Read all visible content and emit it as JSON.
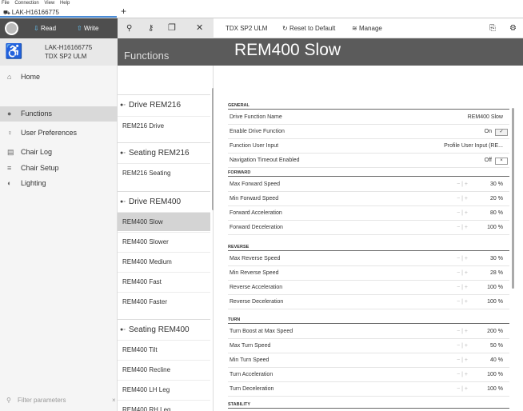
{
  "menu": [
    "File",
    "Connection",
    "View",
    "Help"
  ],
  "tab": {
    "title": "LAK-H16166775",
    "add": "+"
  },
  "toolbar": {
    "read": "Read",
    "write": "Write",
    "device": "TDX SP2 ULM",
    "reset": "Reset to Default",
    "manage": "Manage"
  },
  "device": {
    "id": "LAK-H16166775",
    "model": "TDX SP2 ULM"
  },
  "functions_header": "Functions",
  "page_title": "REM400 Slow",
  "sidebar": {
    "items": [
      {
        "label": "Home",
        "icon": "home-icon",
        "glyph": "⌂"
      },
      {
        "label": "Functions",
        "icon": "functions-icon",
        "glyph": "●"
      },
      {
        "label": "User Preferences",
        "icon": "user-icon",
        "glyph": "♀"
      },
      {
        "label": "Chair Log",
        "icon": "log-icon",
        "glyph": "▤"
      },
      {
        "label": "Chair Setup",
        "icon": "setup-icon",
        "glyph": "≡"
      },
      {
        "label": "Lighting",
        "icon": "lighting-icon",
        "glyph": "◐"
      }
    ],
    "filter_placeholder": "Filter parameters"
  },
  "functions": {
    "groups": [
      {
        "title": "Drive REM216",
        "items": [
          "REM216 Drive"
        ]
      },
      {
        "title": "Seating REM216",
        "items": [
          "REM216 Seating"
        ]
      },
      {
        "title": "Drive REM400",
        "items": [
          "REM400 Slow",
          "REM400 Slower",
          "REM400 Medium",
          "REM400 Fast",
          "REM400 Faster"
        ]
      },
      {
        "title": "Seating REM400",
        "items": [
          "REM400 Tilt",
          "REM400 Recline",
          "REM400 LH Leg",
          "REM400 RH Leg"
        ]
      }
    ]
  },
  "params": {
    "general": {
      "title": "GENERAL",
      "rows": [
        {
          "label": "Drive Function Name",
          "value": "REM400 Slow"
        },
        {
          "label": "Enable Drive Function",
          "value": "On",
          "toggle": "✓"
        },
        {
          "label": "Function User Input",
          "value": "Profile User Input (RE..."
        },
        {
          "label": "Navigation Timeout Enabled",
          "value": "Off",
          "toggle": "×"
        }
      ]
    },
    "forward": {
      "title": "FORWARD",
      "rows": [
        {
          "label": "Max Forward Speed",
          "value": "30 %"
        },
        {
          "label": "Min Forward Speed",
          "value": "20 %"
        },
        {
          "label": "Forward Acceleration",
          "value": "80 %"
        },
        {
          "label": "Forward Deceleration",
          "value": "100 %"
        }
      ]
    },
    "reverse": {
      "title": "REVERSE",
      "rows": [
        {
          "label": "Max Reverse Speed",
          "value": "30 %"
        },
        {
          "label": "Min Reverse Speed",
          "value": "28 %"
        },
        {
          "label": "Reverse Acceleration",
          "value": "100 %"
        },
        {
          "label": "Reverse Deceleration",
          "value": "100 %"
        }
      ]
    },
    "turn": {
      "title": "TURN",
      "rows": [
        {
          "label": "Turn Boost at Max Speed",
          "value": "200 %"
        },
        {
          "label": "Max Turn Speed",
          "value": "50 %"
        },
        {
          "label": "Min Turn Speed",
          "value": "40 %"
        },
        {
          "label": "Turn Acceleration",
          "value": "100 %"
        },
        {
          "label": "Turn Deceleration",
          "value": "100 %"
        }
      ]
    },
    "stability": {
      "title": "STABILITY"
    }
  },
  "stepper": "− | +"
}
